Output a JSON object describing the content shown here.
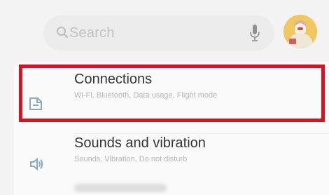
{
  "search": {
    "placeholder": "Search",
    "icon": "search-icon"
  },
  "mic": {
    "icon": "mic-icon"
  },
  "menu": {
    "items": [
      {
        "title": "Connections",
        "subtitle": "Wi-Fi, Bluetooth, Data usage, Flight mode",
        "icon": "connections-icon",
        "highlighted": true
      },
      {
        "title": "Sounds and vibration",
        "subtitle": "Sounds, Vibration, Do not disturb",
        "icon": "speaker-icon",
        "highlighted": false
      }
    ]
  },
  "colors": {
    "background": "#f3f3f3",
    "highlight": "#e10f1c",
    "accent": "#f0c45b",
    "icon": "#8ba8bd"
  }
}
